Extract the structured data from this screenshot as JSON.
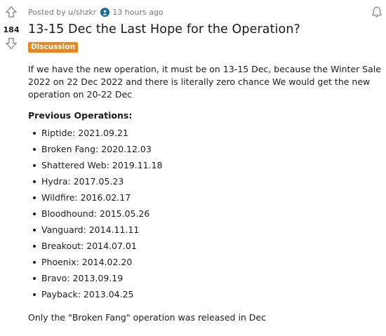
{
  "vote": {
    "count": "184"
  },
  "meta": {
    "posted_by": "Posted by u/shzkr",
    "time": "13 hours ago"
  },
  "post": {
    "title": "13-15 Dec the Last Hope for the Operation?",
    "flair": "Discussion",
    "intro": "If we have the new operation, it must be on 13-15 Dec, because the Winter Sale 2022 on 22 Dec 2022 and there is literally zero chance We would get the new operation on 20-22 Dec",
    "ops_heading": "Previous Operations:",
    "operations": [
      "Riptide: 2021.09.21",
      "Broken Fang: 2020.12.03",
      "Shattered Web: 2019.11.18",
      "Hydra: 2017.05.23",
      "Wildfire: 2016.02.17",
      "Bloodhound: 2015.05.26",
      "Vanguard: 2014.11.11",
      "Breakout: 2014.07.01",
      "Phoenix: 2014.02.20",
      "Bravo: 2013.09.19",
      "Payback: 2013.04.25"
    ],
    "outro": "Only the \"Broken Fang\" operation was released in Dec"
  },
  "icons": {
    "upvote": "arrow-up-outline",
    "downvote": "arrow-down-outline",
    "avatar": "user-avatar",
    "notification": "bell-outline"
  }
}
